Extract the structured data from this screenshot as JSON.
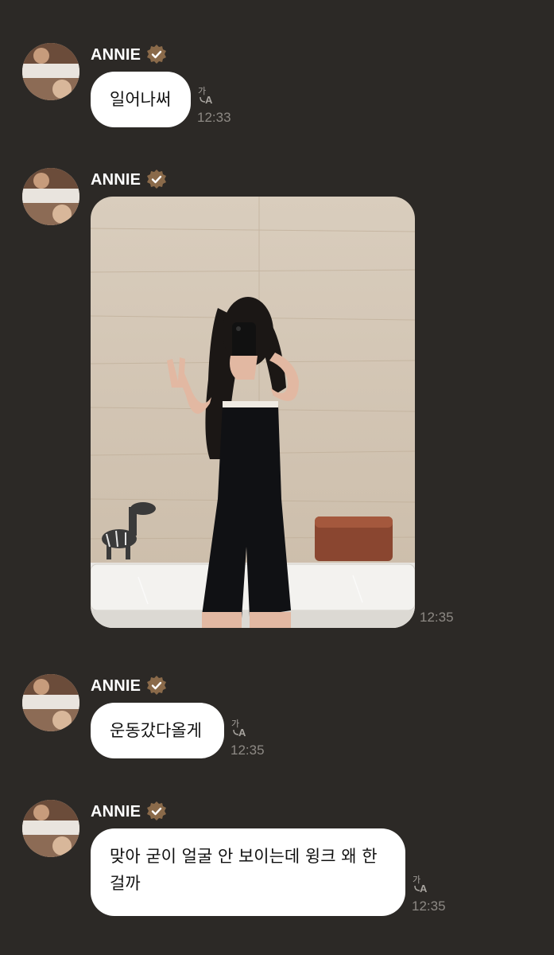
{
  "messages": [
    {
      "sender": "ANNIE",
      "text": "일어나써",
      "time": "12:33",
      "translate_icon": "translate-icon"
    },
    {
      "sender": "ANNIE",
      "image": "mirror-selfie-photo",
      "time": "12:35"
    },
    {
      "sender": "ANNIE",
      "text": "운동갔다올게",
      "time": "12:35",
      "translate_icon": "translate-icon"
    },
    {
      "sender": "ANNIE",
      "text": "맞아 굳이 얼굴 안 보이는데 윙크 왜 한걸까",
      "time": "12:35",
      "translate_icon": "translate-icon"
    }
  ],
  "colors": {
    "background": "#2c2926",
    "bubble": "#ffffff",
    "verified_badge": "#8a6a4a",
    "timestamp": "#8d8984"
  },
  "icons": {
    "verified": "verified-badge-icon",
    "translate": "translate-icon",
    "avatar": "profile-avatar"
  }
}
